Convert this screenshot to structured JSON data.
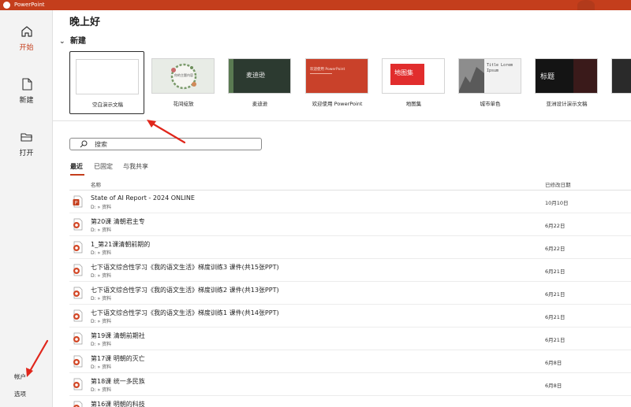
{
  "app": {
    "title": "PowerPoint"
  },
  "sidebar": {
    "items": [
      {
        "label": "开始",
        "icon": "home-icon",
        "active": true
      },
      {
        "label": "新建",
        "icon": "new-file-icon",
        "active": false
      },
      {
        "label": "打开",
        "icon": "folder-open-icon",
        "active": false
      }
    ],
    "bottom": [
      {
        "label": "帐户"
      },
      {
        "label": "选项"
      }
    ]
  },
  "greeting": "晚上好",
  "new_section": {
    "label": "新建",
    "templates": [
      {
        "label": "空白演示文稿",
        "thumb_text": ""
      },
      {
        "label": "花间绽放",
        "thumb_text": "你的主题内容"
      },
      {
        "label": "麦迪逊",
        "thumb_text": "麦迪逊"
      },
      {
        "label": "欢迎使用 PowerPoint",
        "thumb_text": "欢迎使用 PowerPoint"
      },
      {
        "label": "地图集",
        "thumb_text": "地图集"
      },
      {
        "label": "城市单色",
        "thumb_text": "Title Lorem Ipsum"
      },
      {
        "label": "亚洲设计演示文稿",
        "thumb_text": "标题"
      }
    ]
  },
  "search": {
    "placeholder": "搜索"
  },
  "tabs": [
    {
      "label": "最近"
    },
    {
      "label": "已固定"
    },
    {
      "label": "与我共享"
    }
  ],
  "list": {
    "col_name": "名称",
    "col_date": "已修改日期",
    "rows": [
      {
        "name": "State of AI Report - 2024 ONLINE",
        "path": "D: » 资料",
        "date": "10月10日",
        "type": "pptx"
      },
      {
        "name": "第20课  清朝君主专",
        "path": "D: » 资料",
        "date": "6月22日",
        "type": "ppt"
      },
      {
        "name": "1_第21课清朝前期的",
        "path": "D: » 资料",
        "date": "6月22日",
        "type": "ppt"
      },
      {
        "name": "七下语文综合性学习《我的语文生活》梯度训练3 课件(共15张PPT)",
        "path": "D: » 资料",
        "date": "6月21日",
        "type": "ppt"
      },
      {
        "name": "七下语文综合性学习《我的语文生活》梯度训练2 课件(共13张PPT)",
        "path": "D: » 资料",
        "date": "6月21日",
        "type": "ppt"
      },
      {
        "name": "七下语文综合性学习《我的语文生活》梯度训练1 课件(共14张PPT)",
        "path": "D: » 资料",
        "date": "6月21日",
        "type": "ppt"
      },
      {
        "name": "第19课  清朝前期社",
        "path": "D: » 资料",
        "date": "6月21日",
        "type": "ppt"
      },
      {
        "name": "第17课 明朝的灭亡",
        "path": "D: » 资料",
        "date": "6月8日",
        "type": "ppt"
      },
      {
        "name": "第18课  统一多民族",
        "path": "D: » 资料",
        "date": "6月8日",
        "type": "ppt"
      },
      {
        "name": "第16课  明朝的科技",
        "path": "D: » 资料",
        "date": "",
        "type": "ppt"
      }
    ]
  },
  "colors": {
    "accent": "#c43e1c",
    "annotation_arrow": "#e0261b"
  }
}
